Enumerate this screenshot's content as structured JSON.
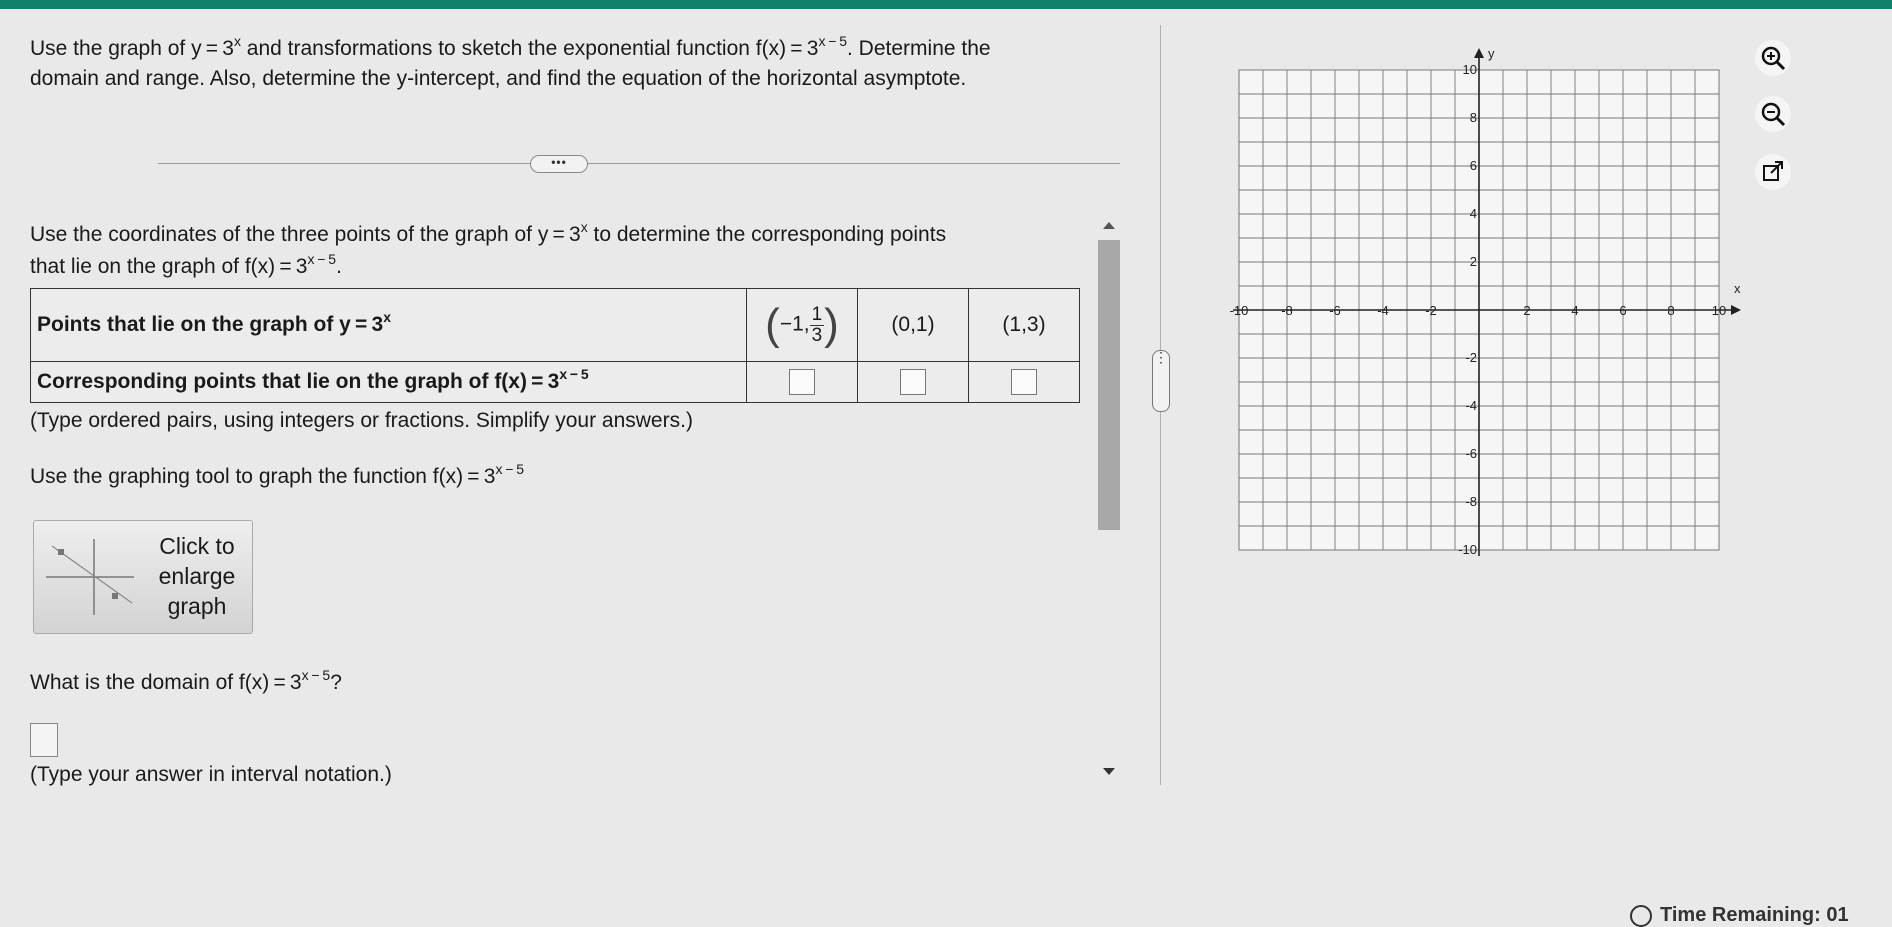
{
  "question": {
    "line1_a": "Use the graph of y = 3",
    "line1_sup1": "x",
    "line1_b": " and transformations to sketch the exponential function f(x) = 3",
    "line1_sup2": "x − 5",
    "line1_c": ". Determine the",
    "line2": "domain and range. Also, determine the y-intercept, and find the equation of the horizontal asymptote."
  },
  "more_button": "•••",
  "part1": {
    "line1_a": "Use the coordinates of the three points of the graph of y = 3",
    "line1_sup": "x",
    "line1_b": " to determine the corresponding points",
    "line2_a": "that lie on the graph of f(x) = 3",
    "line2_sup": "x − 5",
    "line2_b": "."
  },
  "table": {
    "row1_label": "Points that lie on the graph of y = 3",
    "row1_sup": "x",
    "point1_x": "−1,",
    "point1_num": "1",
    "point1_den": "3",
    "point2": "(0,1)",
    "point3": "(1,3)",
    "row2_label": "Corresponding points that lie on the graph of f(x) = 3",
    "row2_sup": "x − 5"
  },
  "hint1": "(Type ordered pairs, using integers or fractions. Simplify your answers.)",
  "graph_instruction_a": "Use the graphing tool to graph the function f(x) = 3",
  "graph_instruction_sup": "x − 5",
  "enlarge_label": "Click to enlarge graph",
  "domain_question_a": "What is the domain of f(x) = 3",
  "domain_question_sup": "x − 5",
  "domain_question_b": "?",
  "hint2": "(Type your answer in interval notation.)",
  "graph": {
    "x_label": "x",
    "y_label": "y",
    "x_ticks": [
      "-10",
      "-8",
      "-6",
      "-4",
      "-2",
      "2",
      "4",
      "6",
      "8",
      "10"
    ],
    "y_ticks": [
      "10",
      "8",
      "6",
      "4",
      "2",
      "-2",
      "-4",
      "-6",
      "-8",
      "-10"
    ]
  },
  "tools": [
    "zoom-in-icon",
    "zoom-out-icon",
    "external-link-icon"
  ],
  "status": "Time Remaining: 01"
}
